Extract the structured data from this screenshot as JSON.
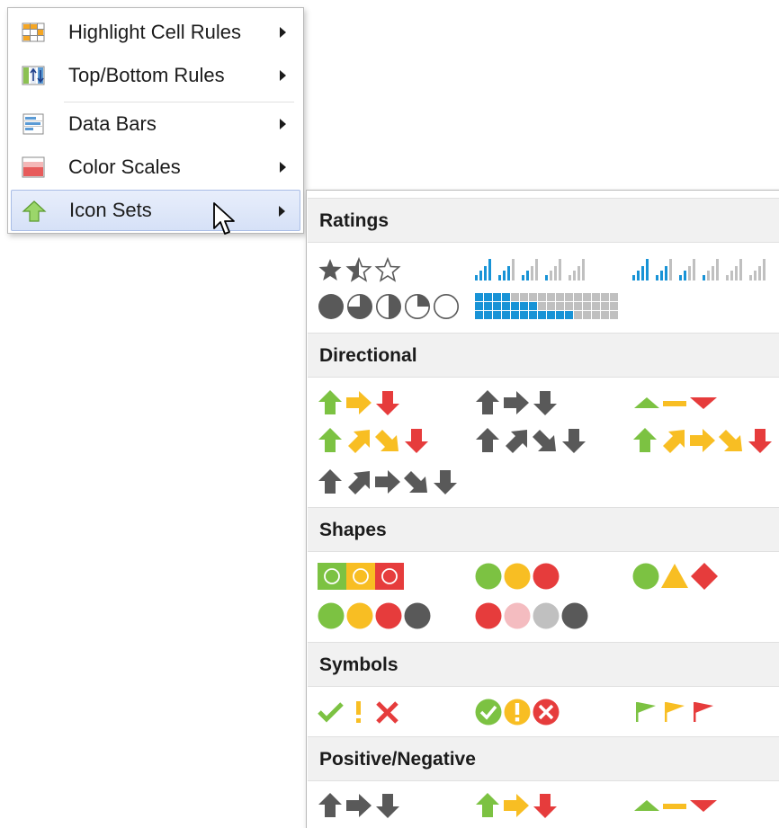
{
  "menu": {
    "items": [
      {
        "label": "Highlight Cell Rules",
        "icon": "highlight-cell-rules-icon"
      },
      {
        "label": "Top/Bottom Rules",
        "icon": "top-bottom-rules-icon"
      },
      {
        "label": "Data Bars",
        "icon": "data-bars-icon"
      },
      {
        "label": "Color Scales",
        "icon": "color-scales-icon"
      },
      {
        "label": "Icon Sets",
        "icon": "icon-sets-icon",
        "active": true
      }
    ]
  },
  "submenu": {
    "groups": [
      {
        "label": "Ratings"
      },
      {
        "label": "Directional"
      },
      {
        "label": "Shapes"
      },
      {
        "label": "Symbols"
      },
      {
        "label": "Positive/Negative"
      }
    ]
  },
  "colors": {
    "green": "#7cc242",
    "yellow": "#f8be23",
    "red": "#e63c3c",
    "gray": "#595959",
    "blue": "#1893d6",
    "light_gray": "#c0c0c0",
    "selection_bg": "#dde6f8"
  }
}
